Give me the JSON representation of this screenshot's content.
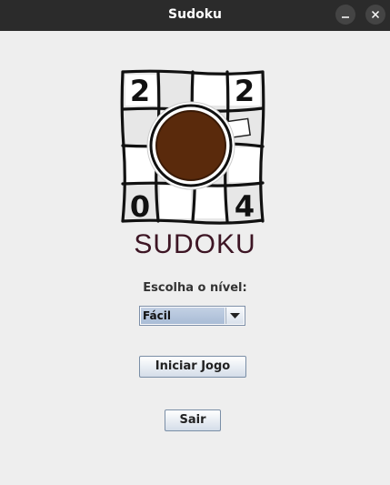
{
  "window": {
    "title": "Sudoku",
    "minimize_icon": "minimize-icon",
    "close_icon": "close-icon"
  },
  "logo": {
    "digits": [
      "2",
      "2",
      "0",
      "4"
    ],
    "brand_text": "SUDOKU",
    "brand_color": "#3d1524",
    "coffee_color": "#5a2a0c"
  },
  "form": {
    "level_label": "Escolha o nível:",
    "level_selected": "Fácil",
    "start_label": "Iniciar Jogo",
    "exit_label": "Sair"
  }
}
